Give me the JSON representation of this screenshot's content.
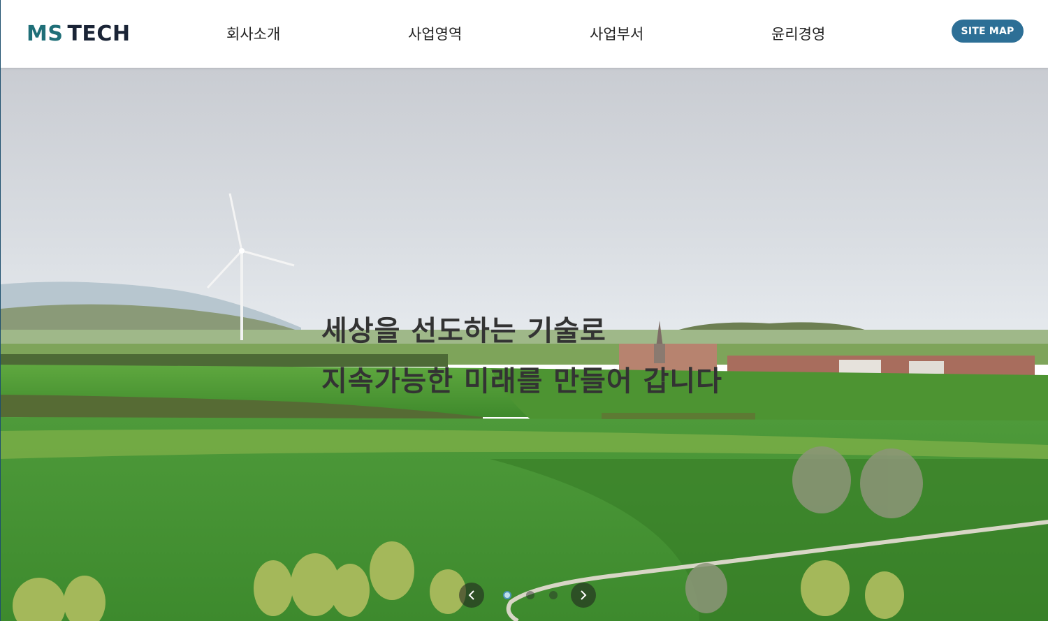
{
  "header": {
    "logo": {
      "part1": "MS",
      "part2": "TECH"
    },
    "nav": [
      {
        "label": "회사소개"
      },
      {
        "label": "사업영역"
      },
      {
        "label": "사업부서"
      },
      {
        "label": "윤리경영"
      }
    ],
    "sitemap_label": "SITE MAP"
  },
  "hero": {
    "headline_line1": "세상을 선도하는 기술로",
    "headline_line2": "지속가능한 미래를 만들어 갑니다",
    "slider": {
      "slide_count": 3,
      "active_slide": 1
    }
  },
  "colors": {
    "brand_teal": "#1f6f78",
    "brand_navy": "#1a2436",
    "sitemap_button": "#2d6f96",
    "headline_text": "#333333"
  },
  "icons": {
    "prev": "chevron-left-icon",
    "next": "chevron-right-icon"
  }
}
